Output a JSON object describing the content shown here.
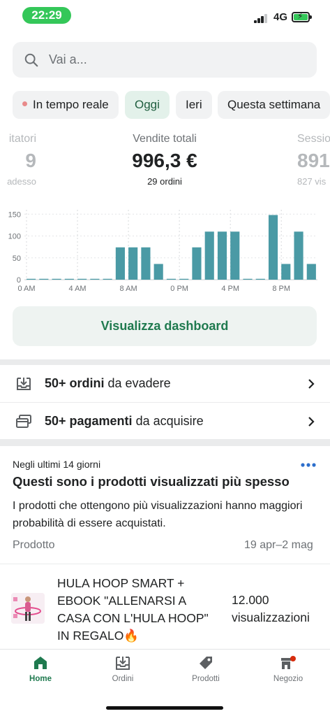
{
  "status_bar": {
    "time": "22:29",
    "network": "4G"
  },
  "search": {
    "placeholder": "Vai a..."
  },
  "filters": [
    {
      "label": "In tempo reale"
    },
    {
      "label": "Oggi"
    },
    {
      "label": "Ieri"
    },
    {
      "label": "Questa settimana"
    }
  ],
  "stats": {
    "left": {
      "label": "itatori",
      "value": "9",
      "sub": "adesso"
    },
    "center": {
      "label": "Vendite totali",
      "value": "996,3 €",
      "sub": "29 ordini"
    },
    "right": {
      "label": "Sessio",
      "value": "891",
      "sub": "827 vis"
    }
  },
  "chart_data": {
    "type": "bar",
    "y_ticks": [
      "150",
      "100",
      "50",
      "0"
    ],
    "ylim": [
      0,
      160
    ],
    "x_tick_labels": [
      "0 AM",
      "4 AM",
      "8 AM",
      "0 PM",
      "4 PM",
      "8 PM"
    ],
    "values": [
      2,
      2,
      2,
      2,
      2,
      2,
      2,
      74,
      74,
      74,
      36,
      2,
      2,
      74,
      110,
      110,
      110,
      2,
      2,
      148,
      36,
      110,
      36
    ],
    "color": "#4a9aa5"
  },
  "dashboard_button": {
    "label": "Visualizza dashboard"
  },
  "tasks": [
    {
      "bold": "50+ ordini",
      "rest": " da evadere"
    },
    {
      "bold": "50+ pagamenti",
      "rest": " da acquisire"
    }
  ],
  "card": {
    "eyebrow": "Negli ultimi 14 giorni",
    "title": "Questi sono i prodotti visualizzati più spesso",
    "description": "I prodotti che ottengono più visualizzazioni hanno maggiori probabilità di essere acquistati.",
    "col_product": "Prodotto",
    "col_period": "19 apr–2 mag",
    "product_name": "HULA HOOP SMART + EBOOK \"ALLENARSI A CASA CON L'HULA HOOP\" IN REGALO🔥",
    "product_views": "12.000 visualizzazioni"
  },
  "tabbar": [
    {
      "label": "Home",
      "icon": "home-icon"
    },
    {
      "label": "Ordini",
      "icon": "orders-icon"
    },
    {
      "label": "Prodotti",
      "icon": "tag-icon"
    },
    {
      "label": "Negozio",
      "icon": "store-icon"
    }
  ],
  "colors": {
    "accent": "#1f7a4f",
    "bar": "#4a9aa5",
    "live_dot": "#e88a8a"
  }
}
